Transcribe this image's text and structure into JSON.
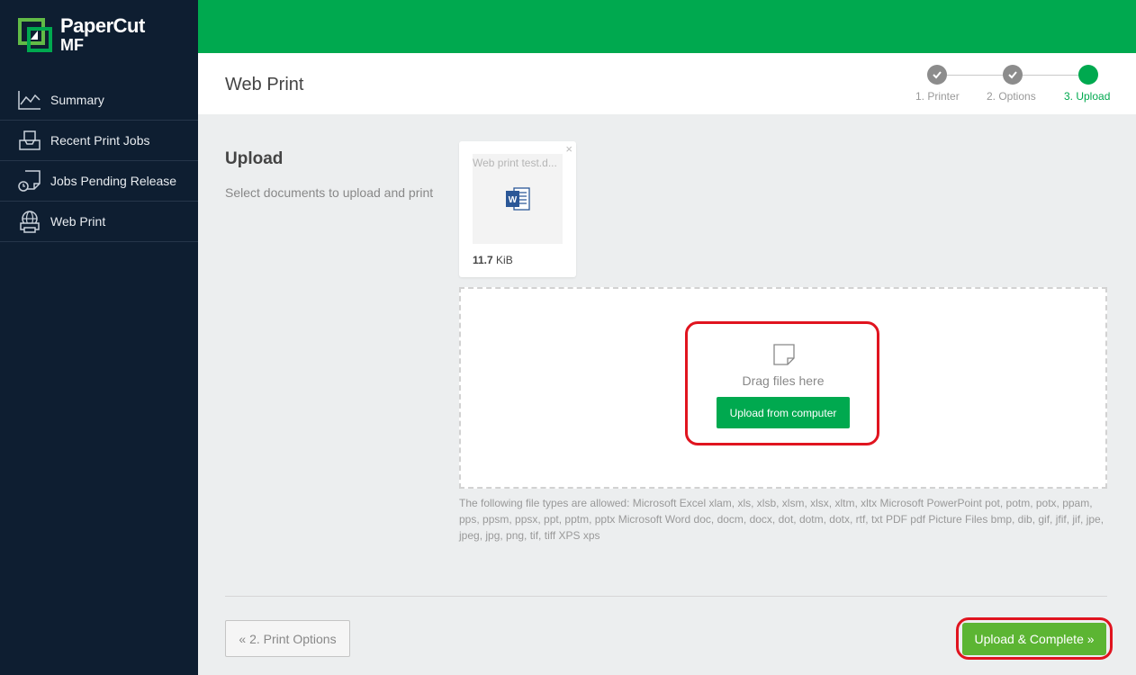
{
  "brand": {
    "name_line1": "PaperCut",
    "name_line2": "MF",
    "accent": "#00a94f",
    "sidebar_bg": "#0e1e31",
    "highlight": "#e0141f"
  },
  "sidebar": {
    "items": [
      {
        "label": "Summary",
        "icon": "chart-line-icon"
      },
      {
        "label": "Recent Print Jobs",
        "icon": "printer-tray-icon"
      },
      {
        "label": "Jobs Pending Release",
        "icon": "pending-release-icon"
      },
      {
        "label": "Web Print",
        "icon": "web-print-icon"
      }
    ]
  },
  "header": {
    "title": "Web Print",
    "steps": [
      {
        "label": "1. Printer",
        "state": "done"
      },
      {
        "label": "2. Options",
        "state": "done"
      },
      {
        "label": "3. Upload",
        "state": "active"
      }
    ]
  },
  "upload": {
    "title": "Upload",
    "description": "Select documents to upload and print",
    "file": {
      "name": "Web print test.d...",
      "size_value": "11.7",
      "size_unit": " KiB",
      "icon": "word-document-icon",
      "close": "×"
    },
    "drop_text": "Drag files here",
    "upload_button": "Upload from computer",
    "allowed_types": "The following file types are allowed: Microsoft Excel xlam, xls, xlsb, xlsm, xlsx, xltm, xltx Microsoft PowerPoint pot, potm, potx, ppam, pps, ppsm, ppsx, ppt, pptm, pptx Microsoft Word doc, docm, docx, dot, dotm, dotx, rtf, txt PDF pdf Picture Files bmp, dib, gif, jfif, jif, jpe, jpeg, jpg, png, tif, tiff XPS xps"
  },
  "footer": {
    "back_button": "« 2. Print Options",
    "complete_button": "Upload & Complete »"
  }
}
